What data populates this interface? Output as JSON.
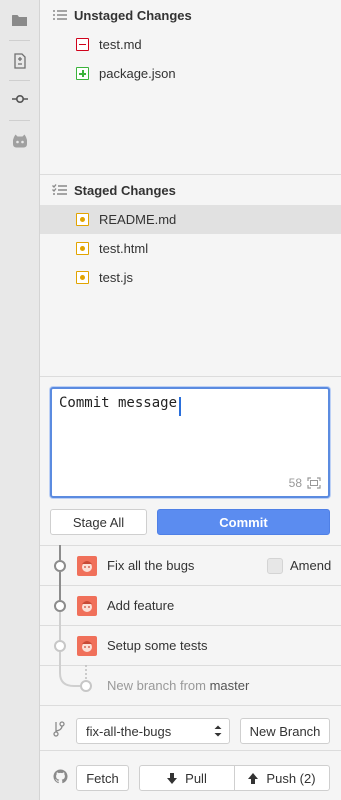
{
  "unstaged": {
    "title": "Unstaged Changes",
    "files": [
      {
        "name": "test.md",
        "status": "removed"
      },
      {
        "name": "package.json",
        "status": "added"
      }
    ]
  },
  "staged": {
    "title": "Staged Changes",
    "files": [
      {
        "name": "README.md",
        "status": "modified",
        "selected": true
      },
      {
        "name": "test.html",
        "status": "modified"
      },
      {
        "name": "test.js",
        "status": "modified"
      }
    ]
  },
  "commit": {
    "placeholder": "Commit message",
    "char_count": "58",
    "stage_all_label": "Stage All",
    "commit_label": "Commit"
  },
  "history": {
    "commits": [
      {
        "message": "Fix all the bugs"
      },
      {
        "message": "Add feature"
      },
      {
        "message": "Setup some tests"
      }
    ],
    "amend_label": "Amend",
    "new_branch_prefix": "New branch from ",
    "new_branch_base": "master"
  },
  "branch": {
    "current": "fix-all-the-bugs",
    "new_branch_label": "New Branch"
  },
  "remote": {
    "fetch_label": "Fetch",
    "pull_label": "Pull",
    "push_label": "Push (2)"
  },
  "colors": {
    "accent": "#5b8cf0",
    "removed": "#d0021b",
    "added": "#3bb33b",
    "modified": "#e2a400",
    "avatar": "#f0705a"
  },
  "icons": [
    "folder-icon",
    "diff-icon",
    "commit-icon",
    "github-icon",
    "list-icon",
    "checklist-icon",
    "branch-icon",
    "octocat-icon",
    "arrow-down-icon",
    "arrow-up-icon",
    "expand-icon"
  ]
}
